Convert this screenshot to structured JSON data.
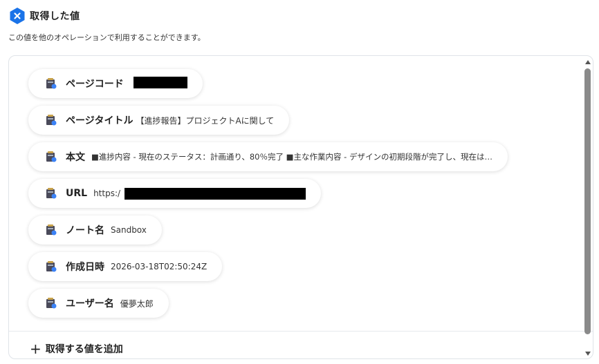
{
  "header": {
    "title": "取得した値",
    "subtitle": "この値を他のオペレーションで利用することができます。",
    "badge_icon": "x-hexagon-icon",
    "accent_color": "#1a73e8"
  },
  "fields": [
    {
      "label": "ページコード",
      "value": "",
      "redacted": true,
      "icon": "db-app-icon"
    },
    {
      "label": "ページタイトル",
      "value": "【進捗報告】プロジェクトAに関して",
      "icon": "db-app-icon"
    },
    {
      "label": "本文",
      "value": "■進捗内容 - 現在のステータス：計画通り、80％完了 ■主な作業内容 - デザインの初期段階が完了し、現在は…",
      "icon": "db-app-icon"
    },
    {
      "label": "URL",
      "value": "https:/",
      "redacted": true,
      "icon": "db-app-icon"
    },
    {
      "label": "ノート名",
      "value": "Sandbox",
      "icon": "db-app-icon"
    },
    {
      "label": "作成日時",
      "value": "2026-03-18T02:50:24Z",
      "icon": "db-app-icon"
    },
    {
      "label": "ユーザー名",
      "value": "優夢太郎",
      "icon": "db-app-icon"
    }
  ],
  "add_button": {
    "label": "取得する値を追加",
    "icon": "plus-icon"
  }
}
